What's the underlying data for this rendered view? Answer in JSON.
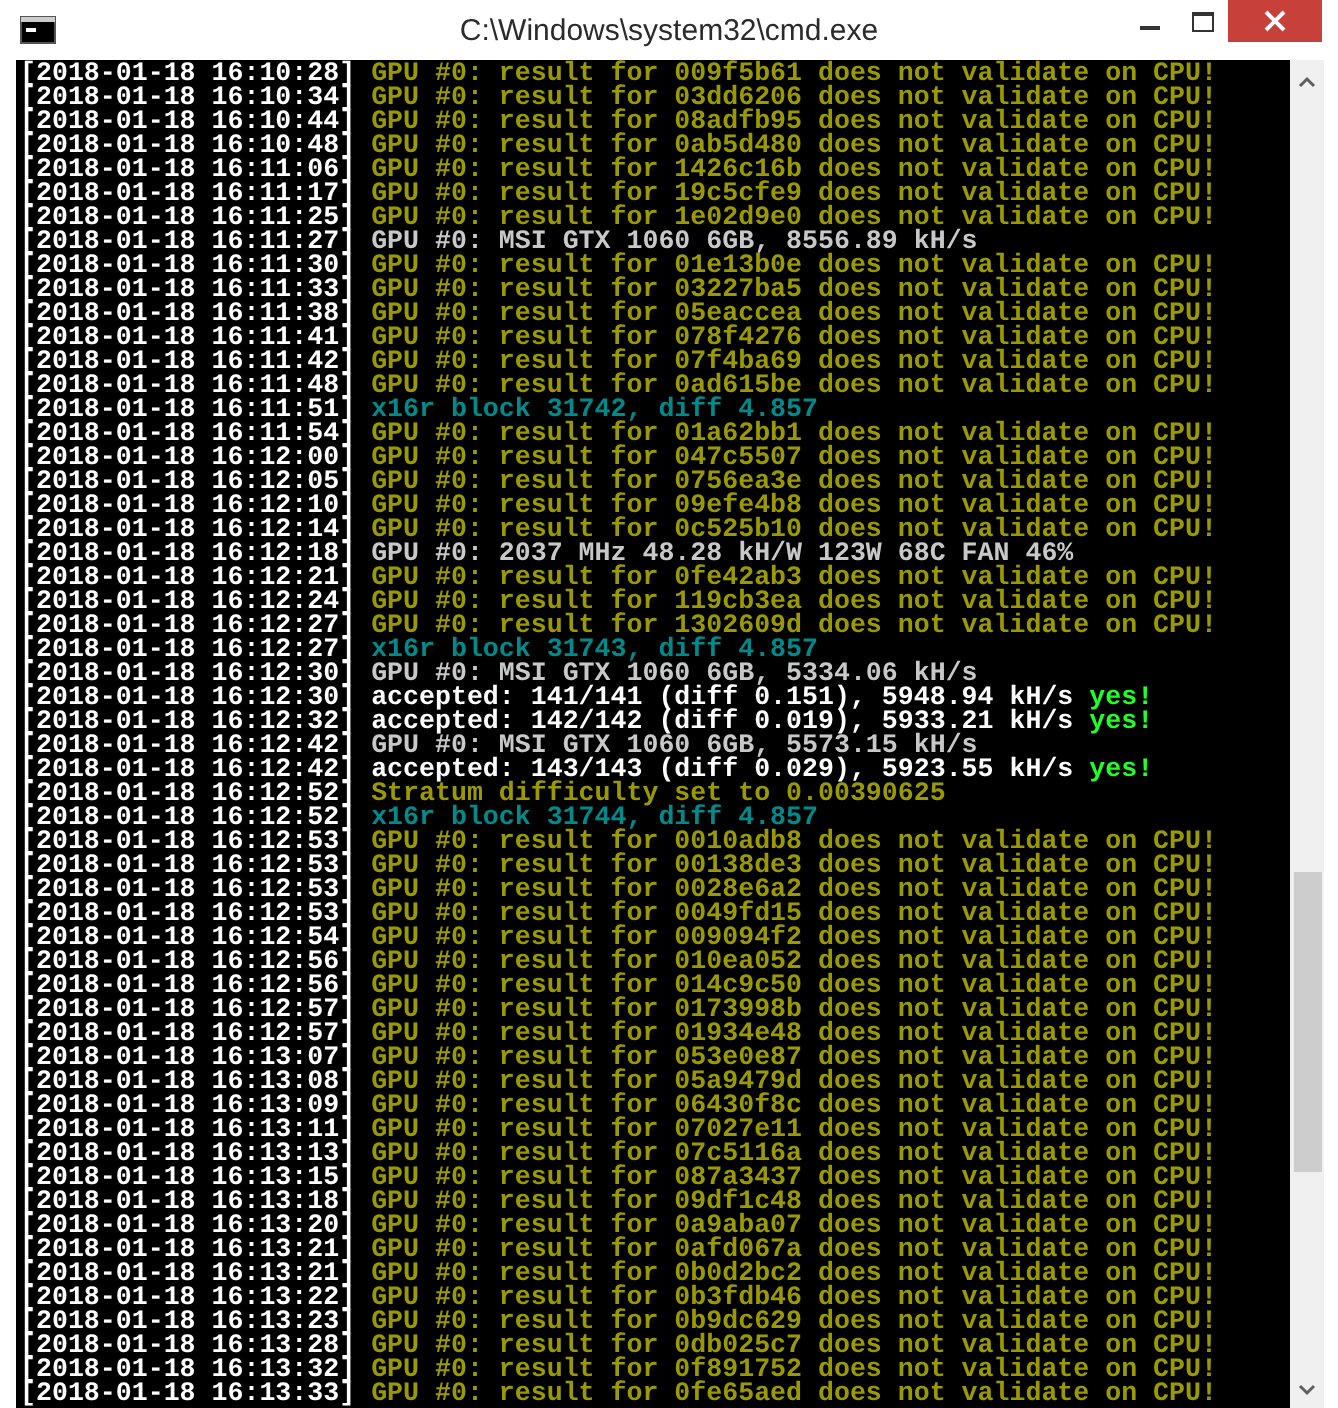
{
  "window": {
    "title": "C:\\Windows\\system32\\cmd.exe"
  },
  "console_lines": [
    {
      "time": "[2018-01-18 16:10:28]",
      "kind": "warn",
      "text": "GPU #0: result for 009f5b61 does not validate on CPU!"
    },
    {
      "time": "[2018-01-18 16:10:34]",
      "kind": "warn",
      "text": "GPU #0: result for 03dd6206 does not validate on CPU!"
    },
    {
      "time": "[2018-01-18 16:10:44]",
      "kind": "warn",
      "text": "GPU #0: result for 08adfb95 does not validate on CPU!"
    },
    {
      "time": "[2018-01-18 16:10:48]",
      "kind": "warn",
      "text": "GPU #0: result for 0ab5d480 does not validate on CPU!"
    },
    {
      "time": "[2018-01-18 16:11:06]",
      "kind": "warn",
      "text": "GPU #0: result for 1426c16b does not validate on CPU!"
    },
    {
      "time": "[2018-01-18 16:11:17]",
      "kind": "warn",
      "text": "GPU #0: result for 19c5cfe9 does not validate on CPU!"
    },
    {
      "time": "[2018-01-18 16:11:25]",
      "kind": "warn",
      "text": "GPU #0: result for 1e02d9e0 does not validate on CPU!"
    },
    {
      "time": "[2018-01-18 16:11:27]",
      "kind": "info",
      "text": "GPU #0: MSI GTX 1060 6GB, 8556.89 kH/s"
    },
    {
      "time": "[2018-01-18 16:11:30]",
      "kind": "warn",
      "text": "GPU #0: result for 01e13b0e does not validate on CPU!"
    },
    {
      "time": "[2018-01-18 16:11:33]",
      "kind": "warn",
      "text": "GPU #0: result for 03227ba5 does not validate on CPU!"
    },
    {
      "time": "[2018-01-18 16:11:38]",
      "kind": "warn",
      "text": "GPU #0: result for 05eaccea does not validate on CPU!"
    },
    {
      "time": "[2018-01-18 16:11:41]",
      "kind": "warn",
      "text": "GPU #0: result for 078f4276 does not validate on CPU!"
    },
    {
      "time": "[2018-01-18 16:11:42]",
      "kind": "warn",
      "text": "GPU #0: result for 07f4ba69 does not validate on CPU!"
    },
    {
      "time": "[2018-01-18 16:11:48]",
      "kind": "warn",
      "text": "GPU #0: result for 0ad615be does not validate on CPU!"
    },
    {
      "time": "[2018-01-18 16:11:51]",
      "kind": "block",
      "text": "x16r block 31742, diff 4.857"
    },
    {
      "time": "[2018-01-18 16:11:54]",
      "kind": "warn",
      "text": "GPU #0: result for 01a62bb1 does not validate on CPU!"
    },
    {
      "time": "[2018-01-18 16:12:00]",
      "kind": "warn",
      "text": "GPU #0: result for 047c5507 does not validate on CPU!"
    },
    {
      "time": "[2018-01-18 16:12:05]",
      "kind": "warn",
      "text": "GPU #0: result for 0756ea3e does not validate on CPU!"
    },
    {
      "time": "[2018-01-18 16:12:10]",
      "kind": "warn",
      "text": "GPU #0: result for 09efe4b8 does not validate on CPU!"
    },
    {
      "time": "[2018-01-18 16:12:14]",
      "kind": "warn",
      "text": "GPU #0: result for 0c525b10 does not validate on CPU!"
    },
    {
      "time": "[2018-01-18 16:12:18]",
      "kind": "info",
      "text": "GPU #0: 2037 MHz 48.28 kH/W 123W 68C FAN 46%"
    },
    {
      "time": "[2018-01-18 16:12:21]",
      "kind": "warn",
      "text": "GPU #0: result for 0fe42ab3 does not validate on CPU!"
    },
    {
      "time": "[2018-01-18 16:12:24]",
      "kind": "warn",
      "text": "GPU #0: result for 119cb3ea does not validate on CPU!"
    },
    {
      "time": "[2018-01-18 16:12:27]",
      "kind": "warn",
      "text": "GPU #0: result for 1302609d does not validate on CPU!"
    },
    {
      "time": "[2018-01-18 16:12:27]",
      "kind": "block",
      "text": "x16r block 31743, diff 4.857"
    },
    {
      "time": "[2018-01-18 16:12:30]",
      "kind": "info",
      "text": "GPU #0: MSI GTX 1060 6GB, 5334.06 kH/s"
    },
    {
      "time": "[2018-01-18 16:12:30]",
      "kind": "accepted",
      "text": "accepted: 141/141 (diff 0.151), 5948.94 kH/s",
      "flag": "yes!"
    },
    {
      "time": "[2018-01-18 16:12:32]",
      "kind": "accepted",
      "text": "accepted: 142/142 (diff 0.019), 5933.21 kH/s",
      "flag": "yes!"
    },
    {
      "time": "[2018-01-18 16:12:42]",
      "kind": "info",
      "text": "GPU #0: MSI GTX 1060 6GB, 5573.15 kH/s"
    },
    {
      "time": "[2018-01-18 16:12:42]",
      "kind": "accepted",
      "text": "accepted: 143/143 (diff 0.029), 5923.55 kH/s",
      "flag": "yes!"
    },
    {
      "time": "[2018-01-18 16:12:52]",
      "kind": "warn",
      "text": "Stratum difficulty set to 0.00390625"
    },
    {
      "time": "[2018-01-18 16:12:52]",
      "kind": "block",
      "text": "x16r block 31744, diff 4.857"
    },
    {
      "time": "[2018-01-18 16:12:53]",
      "kind": "warn",
      "text": "GPU #0: result for 0010adb8 does not validate on CPU!"
    },
    {
      "time": "[2018-01-18 16:12:53]",
      "kind": "warn",
      "text": "GPU #0: result for 00138de3 does not validate on CPU!"
    },
    {
      "time": "[2018-01-18 16:12:53]",
      "kind": "warn",
      "text": "GPU #0: result for 0028e6a2 does not validate on CPU!"
    },
    {
      "time": "[2018-01-18 16:12:53]",
      "kind": "warn",
      "text": "GPU #0: result for 0049fd15 does not validate on CPU!"
    },
    {
      "time": "[2018-01-18 16:12:54]",
      "kind": "warn",
      "text": "GPU #0: result for 009094f2 does not validate on CPU!"
    },
    {
      "time": "[2018-01-18 16:12:56]",
      "kind": "warn",
      "text": "GPU #0: result for 010ea052 does not validate on CPU!"
    },
    {
      "time": "[2018-01-18 16:12:56]",
      "kind": "warn",
      "text": "GPU #0: result for 014c9c50 does not validate on CPU!"
    },
    {
      "time": "[2018-01-18 16:12:57]",
      "kind": "warn",
      "text": "GPU #0: result for 0173998b does not validate on CPU!"
    },
    {
      "time": "[2018-01-18 16:12:57]",
      "kind": "warn",
      "text": "GPU #0: result for 01934e48 does not validate on CPU!"
    },
    {
      "time": "[2018-01-18 16:13:07]",
      "kind": "warn",
      "text": "GPU #0: result for 053e0e87 does not validate on CPU!"
    },
    {
      "time": "[2018-01-18 16:13:08]",
      "kind": "warn",
      "text": "GPU #0: result for 05a9479d does not validate on CPU!"
    },
    {
      "time": "[2018-01-18 16:13:09]",
      "kind": "warn",
      "text": "GPU #0: result for 06430f8c does not validate on CPU!"
    },
    {
      "time": "[2018-01-18 16:13:11]",
      "kind": "warn",
      "text": "GPU #0: result for 07027e11 does not validate on CPU!"
    },
    {
      "time": "[2018-01-18 16:13:13]",
      "kind": "warn",
      "text": "GPU #0: result for 07c5116a does not validate on CPU!"
    },
    {
      "time": "[2018-01-18 16:13:15]",
      "kind": "warn",
      "text": "GPU #0: result for 087a3437 does not validate on CPU!"
    },
    {
      "time": "[2018-01-18 16:13:18]",
      "kind": "warn",
      "text": "GPU #0: result for 09df1c48 does not validate on CPU!"
    },
    {
      "time": "[2018-01-18 16:13:20]",
      "kind": "warn",
      "text": "GPU #0: result for 0a9aba07 does not validate on CPU!"
    },
    {
      "time": "[2018-01-18 16:13:21]",
      "kind": "warn",
      "text": "GPU #0: result for 0afd067a does not validate on CPU!"
    },
    {
      "time": "[2018-01-18 16:13:21]",
      "kind": "warn",
      "text": "GPU #0: result for 0b0d2bc2 does not validate on CPU!"
    },
    {
      "time": "[2018-01-18 16:13:22]",
      "kind": "warn",
      "text": "GPU #0: result for 0b3fdb46 does not validate on CPU!"
    },
    {
      "time": "[2018-01-18 16:13:23]",
      "kind": "warn",
      "text": "GPU #0: result for 0b9dc629 does not validate on CPU!"
    },
    {
      "time": "[2018-01-18 16:13:28]",
      "kind": "warn",
      "text": "GPU #0: result for 0db025c7 does not validate on CPU!"
    },
    {
      "time": "[2018-01-18 16:13:32]",
      "kind": "warn",
      "text": "GPU #0: result for 0f891752 does not validate on CPU!"
    },
    {
      "time": "[2018-01-18 16:13:33]",
      "kind": "warn",
      "text": "GPU #0: result for 0fe65aed does not validate on CPU!"
    }
  ]
}
